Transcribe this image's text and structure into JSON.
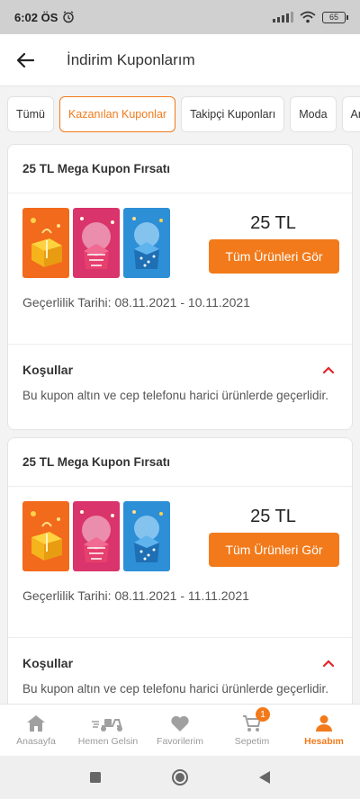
{
  "status_bar": {
    "time": "6:02 ÖS",
    "battery": "65"
  },
  "header": {
    "title": "İndirim Kuponlarım"
  },
  "filters": [
    {
      "label": "Tümü"
    },
    {
      "label": "Kazanılan Kuponlar",
      "active": true
    },
    {
      "label": "Takipçi Kuponları"
    },
    {
      "label": "Moda"
    },
    {
      "label": "Anne"
    }
  ],
  "coupons": [
    {
      "title": "25 TL Mega Kupon Fırsatı",
      "amount": "25 TL",
      "button_label": "Tüm Ürünleri Gör",
      "validity_label": "Geçerlilik Tarihi:",
      "validity_dates": "08.11.2021 - 10.11.2021",
      "conditions_title": "Koşullar",
      "conditions_text": "Bu kupon altın ve cep telefonu harici ürünlerde geçerlidir."
    },
    {
      "title": "25 TL Mega Kupon Fırsatı",
      "amount": "25 TL",
      "button_label": "Tüm Ürünleri Gör",
      "validity_label": "Geçerlilik Tarihi:",
      "validity_dates": "08.11.2021 - 11.11.2021",
      "conditions_title": "Koşullar",
      "conditions_text": "Bu kupon altın ve cep telefonu harici ürünlerde geçerlidir."
    }
  ],
  "bottom_nav": [
    {
      "label": "Anasayfa",
      "icon": "home-icon"
    },
    {
      "label": "Hemen Gelsin",
      "icon": "scooter-icon"
    },
    {
      "label": "Favorilerim",
      "icon": "heart-icon"
    },
    {
      "label": "Sepetim",
      "icon": "cart-icon",
      "badge": "1"
    },
    {
      "label": "Hesabım",
      "icon": "user-icon",
      "active": true
    }
  ],
  "colors": {
    "accent": "#f27a1a",
    "background": "#f3f3f3"
  }
}
